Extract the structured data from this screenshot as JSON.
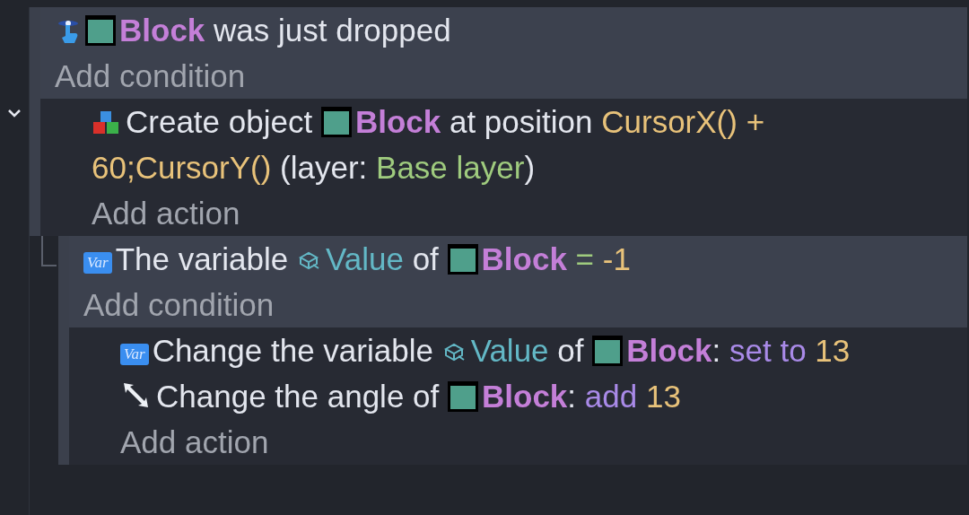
{
  "events": [
    {
      "expanded": true,
      "conditions": [
        {
          "kind": "drop",
          "parts": [
            {
              "kind": "object",
              "text": "Block"
            },
            {
              "kind": "text",
              "text": "was just dropped"
            }
          ]
        }
      ],
      "add_condition": "Add condition",
      "actions": [
        {
          "kind": "create",
          "parts": [
            {
              "kind": "text",
              "text": "Create object"
            },
            {
              "kind": "object",
              "text": "Block"
            },
            {
              "kind": "text",
              "text": "at position"
            },
            {
              "kind": "number",
              "text": "CursorX() +"
            },
            {
              "kind": "number",
              "text": "60;CursorY()"
            },
            {
              "kind": "text",
              "text": "(layer:"
            },
            {
              "kind": "layer",
              "text": "Base layer"
            },
            {
              "kind": "text",
              "text": ")",
              "attach": true
            }
          ]
        }
      ],
      "add_action": "Add action",
      "children": [
        {
          "conditions": [
            {
              "kind": "variable",
              "badge": "Var",
              "parts": [
                {
                  "kind": "text",
                  "text": "The variable"
                },
                {
                  "kind": "variable",
                  "text": "Value"
                },
                {
                  "kind": "text",
                  "text": "of"
                },
                {
                  "kind": "object",
                  "text": "Block"
                },
                {
                  "kind": "operator",
                  "text": "="
                },
                {
                  "kind": "number",
                  "text": "-1"
                }
              ]
            }
          ],
          "add_condition": "Add condition",
          "actions": [
            {
              "kind": "variable",
              "badge": "Var",
              "parts": [
                {
                  "kind": "text",
                  "text": "Change the variable"
                },
                {
                  "kind": "variable",
                  "text": "Value"
                },
                {
                  "kind": "text",
                  "text": "of"
                },
                {
                  "kind": "object",
                  "text": "Block"
                },
                {
                  "kind": "text",
                  "text": ":",
                  "attach": true
                },
                {
                  "kind": "keyword",
                  "text": "set to"
                },
                {
                  "kind": "number",
                  "text": "13"
                }
              ]
            },
            {
              "kind": "angle",
              "parts": [
                {
                  "kind": "text",
                  "text": "Change the angle of"
                },
                {
                  "kind": "object",
                  "text": "Block"
                },
                {
                  "kind": "text",
                  "text": ":",
                  "attach": true
                },
                {
                  "kind": "keyword",
                  "text": "add"
                },
                {
                  "kind": "number",
                  "text": "13"
                }
              ]
            }
          ],
          "add_action": "Add action"
        }
      ]
    }
  ]
}
